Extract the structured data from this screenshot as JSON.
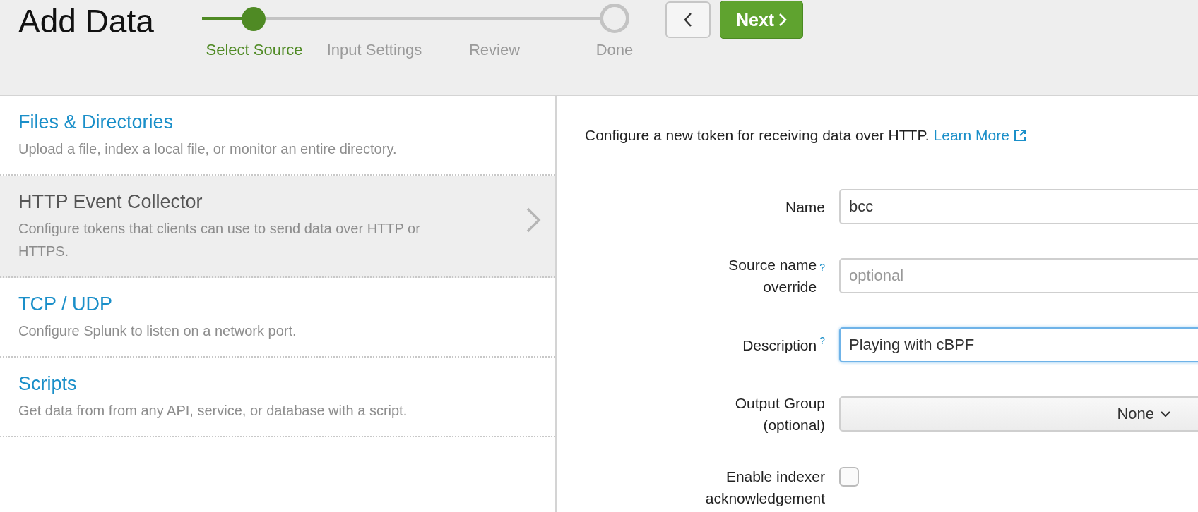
{
  "header": {
    "title": "Add Data",
    "steps": [
      {
        "label": "Select Source",
        "selected": true
      },
      {
        "label": "Input Settings",
        "selected": false
      },
      {
        "label": "Review",
        "selected": false
      },
      {
        "label": "Done",
        "selected": false
      }
    ],
    "next_button": {
      "label": "Next"
    }
  },
  "sources": [
    {
      "title": "Files & Directories",
      "description": "Upload a file, index a local file, or monitor an entire directory.",
      "selected": false
    },
    {
      "title": "HTTP Event Collector",
      "description": "Configure tokens that clients can use to send data over HTTP or HTTPS.",
      "selected": true
    },
    {
      "title": "TCP / UDP",
      "description": "Configure Splunk to listen on a network port.",
      "selected": false
    },
    {
      "title": "Scripts",
      "description": "Get data from from any API, service, or database with a script.",
      "selected": false
    }
  ],
  "intro": {
    "text": "Configure a new token for receiving data over HTTP.",
    "link": "Learn More"
  },
  "form": [
    {
      "kind": "text",
      "label": "Name",
      "value": "bcc",
      "focused": false
    },
    {
      "kind": "text",
      "label": "Source name override",
      "help": "?",
      "placeholder": "optional",
      "focused": false
    },
    {
      "kind": "text",
      "label": "Description",
      "help": "?",
      "value": "Playing with cBPF",
      "focused": true
    },
    {
      "kind": "select",
      "label": "Output Group (optional)",
      "value": "None"
    },
    {
      "kind": "checkbox",
      "label": "Enable indexer acknowledgement",
      "checked": false
    }
  ]
}
